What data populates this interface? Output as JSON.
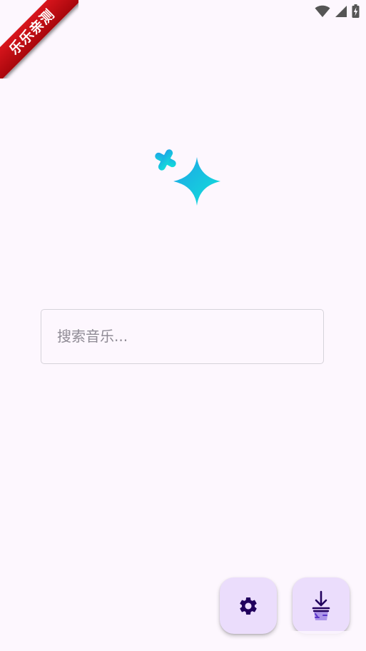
{
  "ribbon": {
    "label": "乐乐亲测"
  },
  "status_bar": {
    "icons": [
      "wifi-icon",
      "signal-icon",
      "battery-charging-icon"
    ]
  },
  "logo": {
    "icon": "sparkle-icon",
    "colors": {
      "start": "#1ea2e8",
      "end": "#12e2d8"
    }
  },
  "search": {
    "placeholder": "搜索音乐...",
    "value": ""
  },
  "fabs": {
    "settings_icon": "gear-icon",
    "download_icon": "download-icon"
  },
  "colors": {
    "background": "#fdf7fe",
    "fab_background": "#ebddfc",
    "fab_icon": "#21005d",
    "ribbon": "#c50d14"
  }
}
